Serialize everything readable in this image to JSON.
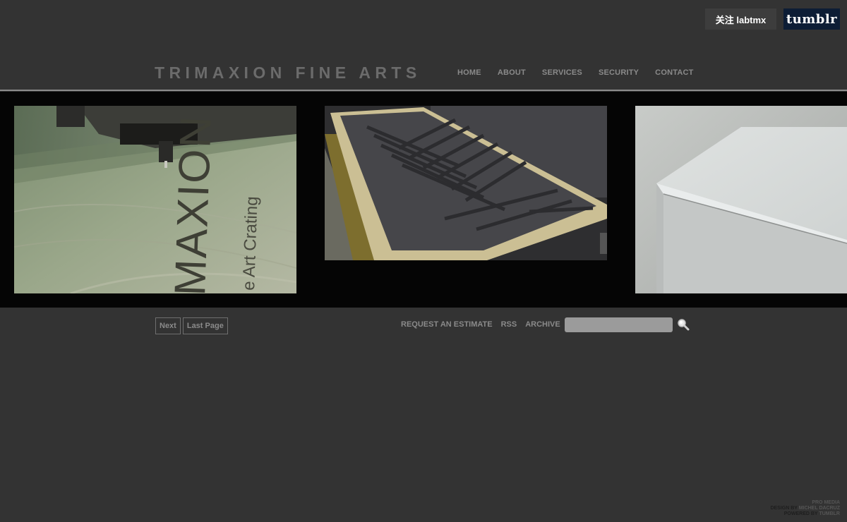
{
  "topbar": {
    "follow_label": "关注 labtmx",
    "tumblr_label": "tumblr"
  },
  "header": {
    "title": "TRIMAXION FINE ARTS",
    "nav": [
      "HOME",
      "ABOUT",
      "SERVICES",
      "SECURITY",
      "CONTACT"
    ]
  },
  "gallery": {
    "photos": [
      {
        "engraved_text_line1": "MAXION",
        "engraved_text_line2": "e Art Crating"
      },
      {},
      {}
    ]
  },
  "pagination": {
    "next_label": "Next",
    "last_label": "Last Page"
  },
  "footer": {
    "links": [
      "REQUEST AN ESTIMATE",
      "RSS",
      "ARCHIVE"
    ],
    "search_value": "",
    "search_icon": "magnifier-icon"
  },
  "credits": {
    "line1": "PRO MEDIA",
    "line2_prefix": "DESIGN BY",
    "line2_name": "MICHEL DACRUZ",
    "line3_prefix": "POWERED BY",
    "line3_name": "TUMBLR"
  },
  "colors": {
    "background": "#333333",
    "gallery_band": "#050505",
    "nav_text": "#8a8a8a",
    "title_text": "#6b6b6b",
    "tumblr_blue": "#0d1d35"
  }
}
